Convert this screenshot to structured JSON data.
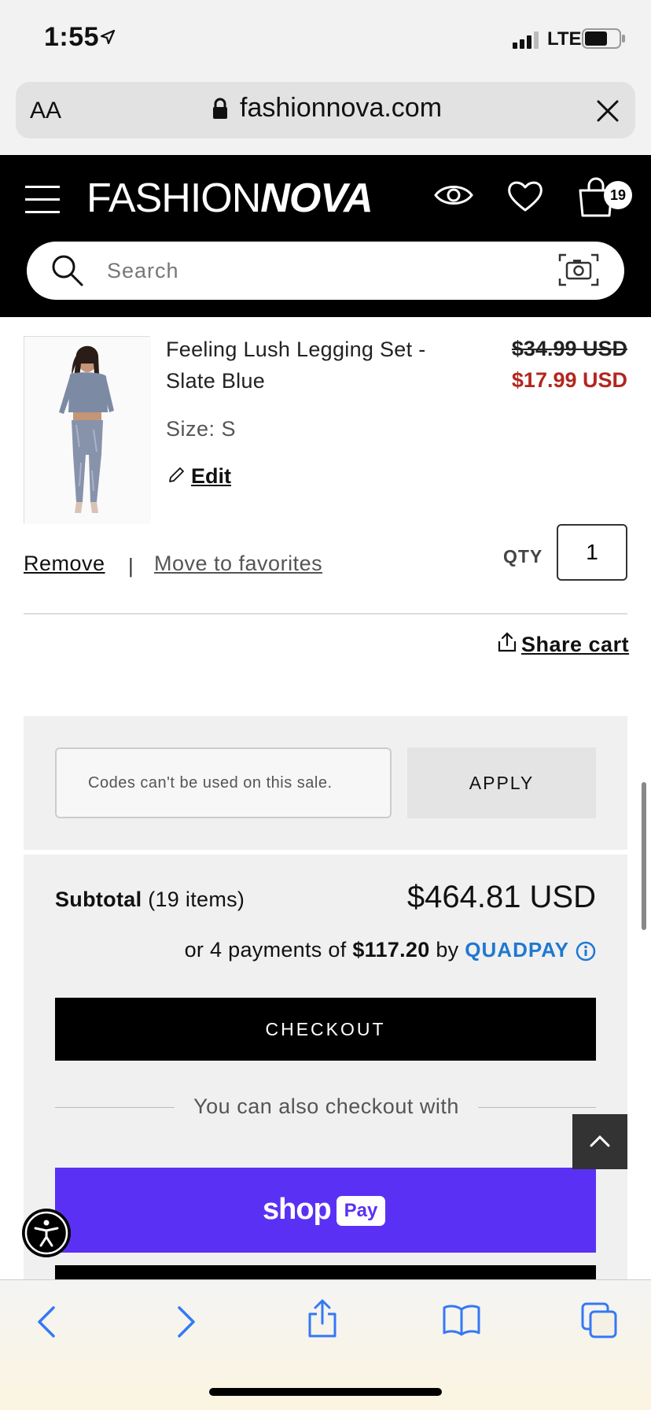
{
  "status_bar": {
    "time": "1:55",
    "network": "LTE"
  },
  "browser": {
    "aa": "AA",
    "url": "fashionnova.com"
  },
  "header": {
    "logo_thin": "FASHION",
    "logo_bold": "NOVA",
    "cart_count": "19",
    "search_placeholder": "Search"
  },
  "cart_item": {
    "name": "Feeling Lush Legging Set - Slate Blue",
    "original_price": "$34.99 USD",
    "sale_price": "$17.99 USD",
    "size": "Size: S",
    "edit_label": "Edit",
    "remove_label": "Remove",
    "separator": "|",
    "move_to_favorites_label": "Move to favorites",
    "qty_label": "QTY",
    "qty_value": "1"
  },
  "share_cart_label": "Share cart",
  "promo": {
    "placeholder": "Codes can't be used on this sale.",
    "apply_label": "APPLY"
  },
  "summary": {
    "subtotal_label": "Subtotal",
    "subtotal_count": "(19 items)",
    "subtotal_value": "$464.81 USD",
    "installments_prefix": "or 4 payments of",
    "installment_amount": "$117.20",
    "installments_by": "by",
    "installments_brand": "QUADPAY",
    "checkout_label": "CHECKOUT",
    "alt_checkout_text": "You can also checkout with",
    "shoppay_text": "shop",
    "shoppay_pill": "Pay"
  },
  "colors": {
    "sale_red": "#b3261e",
    "quadpay_blue": "#1f78d1",
    "shoppay_purple": "#5a31f4"
  }
}
